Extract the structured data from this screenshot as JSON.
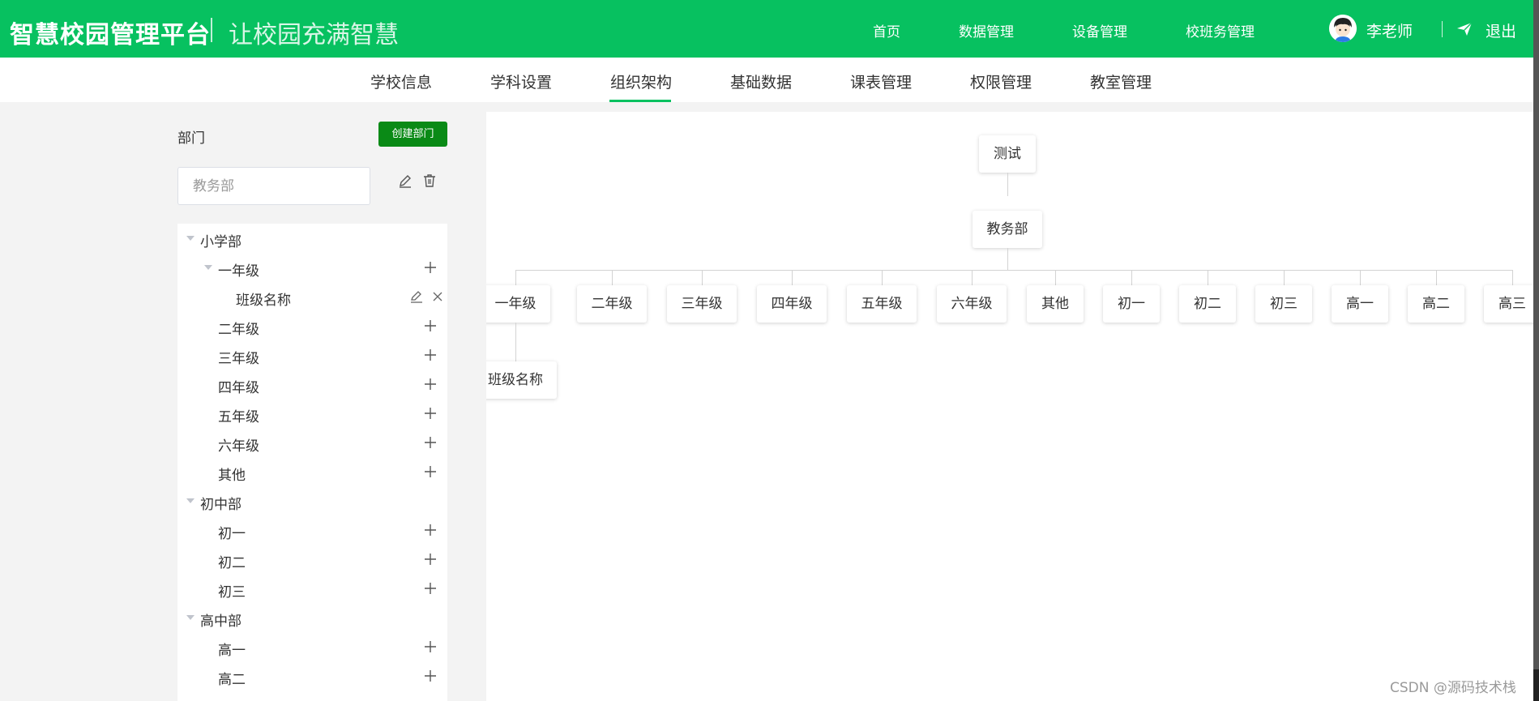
{
  "header": {
    "title": "智慧校园管理平台",
    "slogan": "让校园充满智慧",
    "nav": [
      "首页",
      "数据管理",
      "设备管理",
      "校班务管理"
    ],
    "user_name": "李老师",
    "logout_label": "退出",
    "accent_color": "#07c160"
  },
  "subnav": {
    "items": [
      "学校信息",
      "学科设置",
      "组织架构",
      "基础数据",
      "课表管理",
      "权限管理",
      "教室管理"
    ],
    "active": "组织架构"
  },
  "sidebar": {
    "title": "部门",
    "create_button": "创建部门",
    "department_placeholder": "教务部",
    "tree": [
      {
        "label": "小学部",
        "level": 0,
        "expanded": true
      },
      {
        "label": "一年级",
        "level": 1,
        "expanded": true,
        "action": "plus-icon"
      },
      {
        "label": "班级名称",
        "level": 2,
        "action": "edit-close-icons"
      },
      {
        "label": "二年级",
        "level": 1,
        "action": "plus-icon"
      },
      {
        "label": "三年级",
        "level": 1,
        "action": "plus-icon"
      },
      {
        "label": "四年级",
        "level": 1,
        "action": "plus-icon"
      },
      {
        "label": "五年级",
        "level": 1,
        "action": "plus-icon"
      },
      {
        "label": "六年级",
        "level": 1,
        "action": "plus-icon"
      },
      {
        "label": "其他",
        "level": 1,
        "action": "plus-icon"
      },
      {
        "label": "初中部",
        "level": 0,
        "expanded": true
      },
      {
        "label": "初一",
        "level": 1,
        "action": "plus-icon"
      },
      {
        "label": "初二",
        "level": 1,
        "action": "plus-icon"
      },
      {
        "label": "初三",
        "level": 1,
        "action": "plus-icon"
      },
      {
        "label": "高中部",
        "level": 0,
        "expanded": true
      },
      {
        "label": "高一",
        "level": 1,
        "action": "plus-icon"
      },
      {
        "label": "高二",
        "level": 1,
        "action": "plus-icon"
      }
    ]
  },
  "org_chart": {
    "root": "测试",
    "department": "教务部",
    "children": [
      "一年级",
      "二年级",
      "三年级",
      "四年级",
      "五年级",
      "六年级",
      "其他",
      "初一",
      "初二",
      "初三",
      "高一",
      "高二",
      "高三"
    ],
    "grandchild": "班级名称"
  },
  "watermark": "CSDN @源码技术栈"
}
